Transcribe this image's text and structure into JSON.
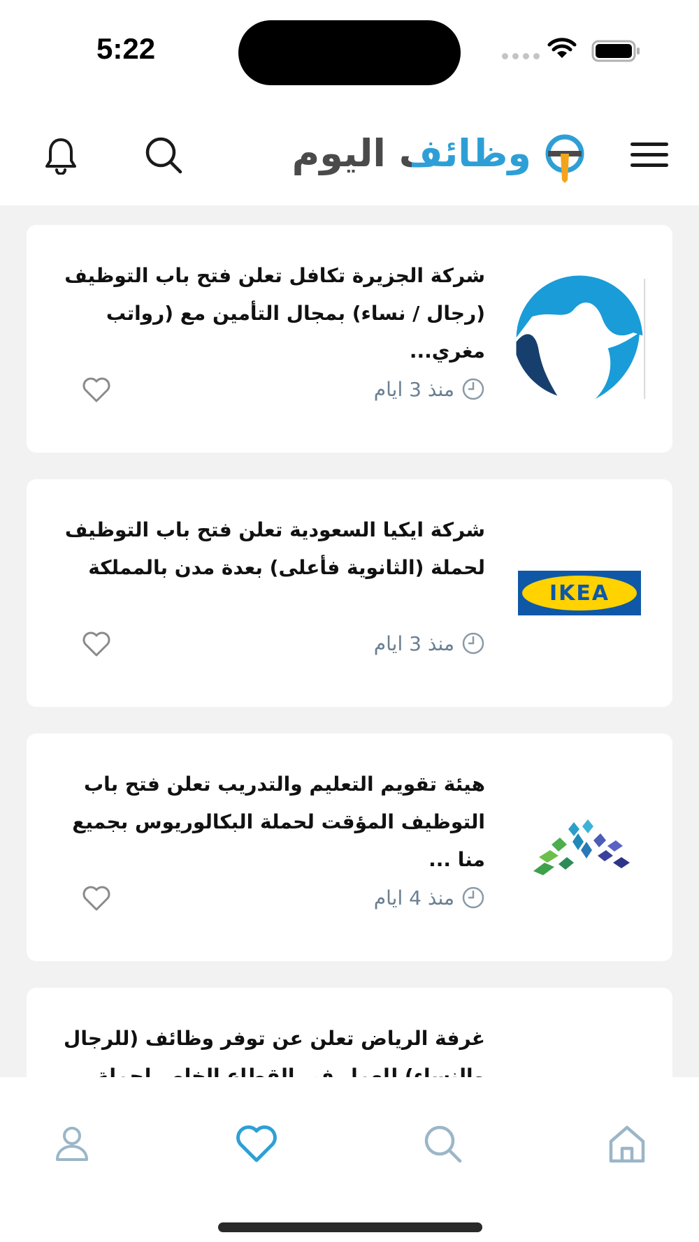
{
  "status_bar": {
    "time": "5:22"
  },
  "header": {
    "app_name": "وظائف اليوم",
    "menu_icon": "hamburger-menu-icon",
    "search_icon": "search-icon",
    "bell_icon": "bell-icon"
  },
  "jobs": [
    {
      "title": "شركة الجزيرة تكافل تعلن فتح باب التوظيف (رجال / نساء) بمجال التأمين مع (رواتب مغري...",
      "time": "منذ 3 ايام",
      "logo": "aljazira-takaful-logo"
    },
    {
      "title": "شركة ايكيا السعودية تعلن فتح باب التوظيف لحملة (الثانوية فأعلى) بعدة مدن بالمملكة",
      "time": "منذ 3 ايام",
      "logo": "ikea-logo",
      "logo_text": "IKEA"
    },
    {
      "title": "هيئة تقويم التعليم والتدريب تعلن فتح باب التوظيف المؤقت لحملة البكالوريوس بجميع منا ...",
      "time": "منذ 4 ايام",
      "logo": "etec-logo"
    },
    {
      "title": "غرفة الرياض تعلن عن توفر وظائف (للرجال والنساء) للعمل في القطاع الخاص لحملة (الثا",
      "time": "",
      "logo": ""
    }
  ],
  "tab_bar": {
    "tabs": [
      {
        "id": "profile",
        "icon": "user-icon"
      },
      {
        "id": "favorites",
        "icon": "heart-icon",
        "active": true
      },
      {
        "id": "search",
        "icon": "search-icon"
      },
      {
        "id": "home",
        "icon": "home-icon"
      }
    ]
  },
  "colors": {
    "accent": "#2e9fd6",
    "inactive_icon": "#9bb6c8",
    "time_text": "#6a7f92",
    "logo_text_dark": "#4a4a4a",
    "logo_tie": "#f2a51c"
  }
}
